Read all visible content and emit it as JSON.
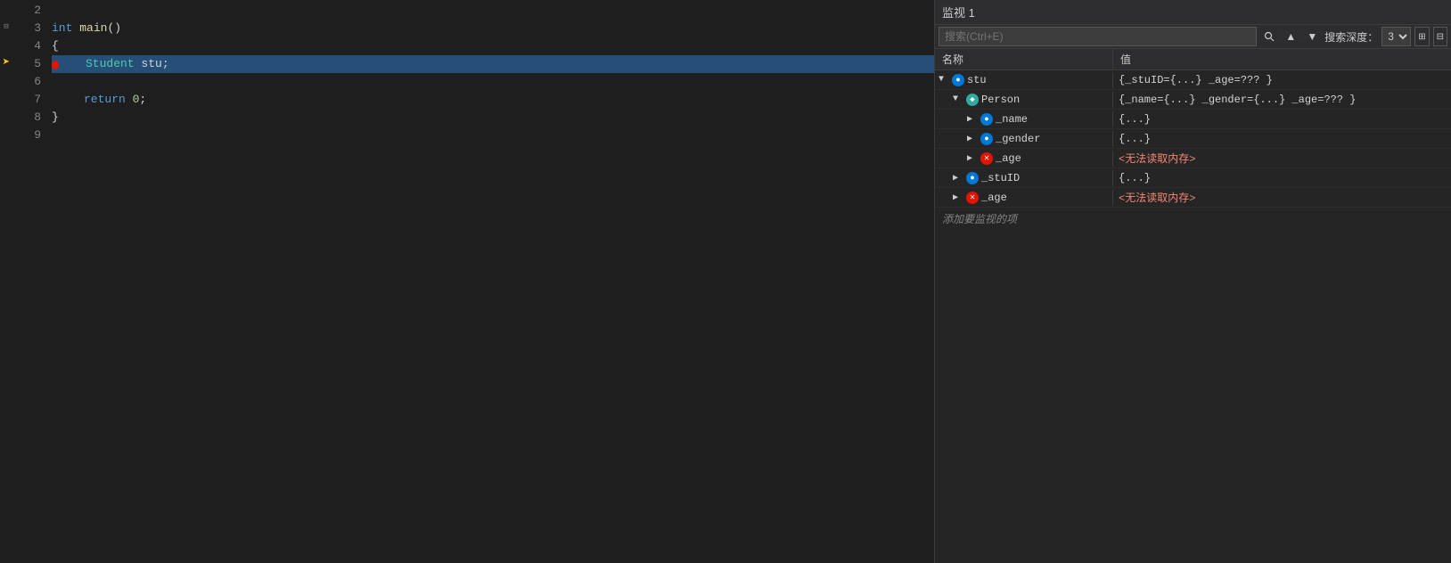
{
  "editor": {
    "lines": [
      {
        "num": 2,
        "content": "",
        "type": "empty"
      },
      {
        "num": 3,
        "content": "int main()",
        "type": "func",
        "hasCollapse": true
      },
      {
        "num": 4,
        "content": "{",
        "type": "brace"
      },
      {
        "num": 5,
        "content": "    Student stu;",
        "type": "code",
        "hasBreakpoint": true,
        "isActive": true
      },
      {
        "num": 6,
        "content": "",
        "type": "empty"
      },
      {
        "num": 7,
        "content": "    return 0;",
        "type": "code"
      },
      {
        "num": 8,
        "content": "}",
        "type": "brace"
      },
      {
        "num": 9,
        "content": "",
        "type": "empty"
      }
    ]
  },
  "watch": {
    "title": "监视 1",
    "search_placeholder": "搜索(Ctrl+E)",
    "search_depth_label": "搜索深度：",
    "search_depth_value": "3",
    "col_name": "名称",
    "col_value": "值",
    "add_watch_label": "添加要监视的项",
    "rows": [
      {
        "id": "stu",
        "level": 0,
        "expand": "▼",
        "icon": "var-blue",
        "name": "stu",
        "value": "{_stuID={...} _age=??? }",
        "value_type": "object"
      },
      {
        "id": "person",
        "level": 1,
        "expand": "▼",
        "icon": "var-teal",
        "name": "Person",
        "value": "{_name={...} _gender={...} _age=??? }",
        "value_type": "object"
      },
      {
        "id": "name",
        "level": 2,
        "expand": "▶",
        "icon": "var-blue",
        "name": "_name",
        "value": "{...}",
        "value_type": "object"
      },
      {
        "id": "gender",
        "level": 2,
        "expand": "▶",
        "icon": "var-blue",
        "name": "_gender",
        "value": "{...}",
        "value_type": "object"
      },
      {
        "id": "age1",
        "level": 2,
        "expand": "▶",
        "icon": "error",
        "name": "_age",
        "value": "<无法读取内存>",
        "value_type": "error"
      },
      {
        "id": "stuID",
        "level": 1,
        "expand": "▶",
        "icon": "var-blue",
        "name": "_stuID",
        "value": "{...}",
        "value_type": "object"
      },
      {
        "id": "age2",
        "level": 1,
        "expand": "▶",
        "icon": "error",
        "name": "_age",
        "value": "<无法读取内存>",
        "value_type": "error"
      }
    ]
  }
}
